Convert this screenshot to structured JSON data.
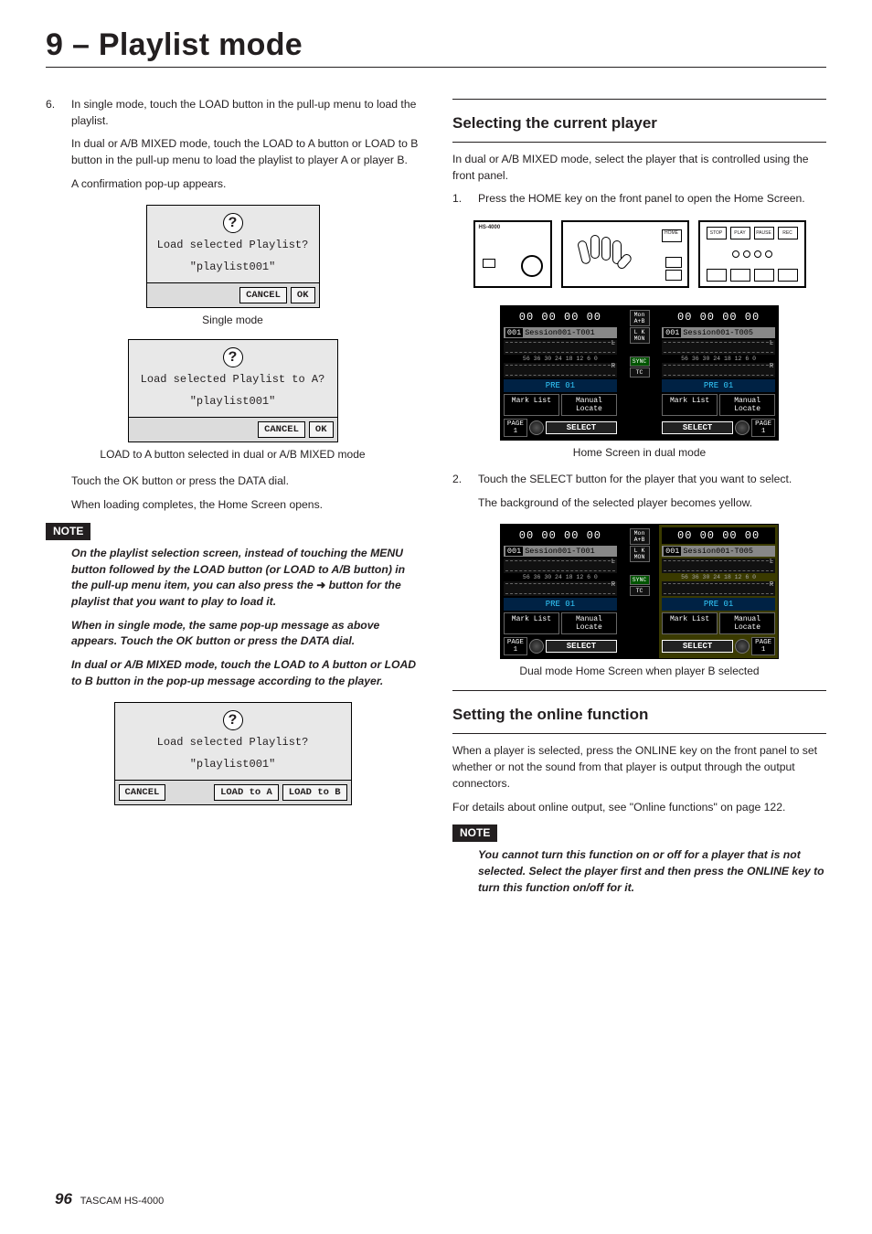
{
  "page": {
    "chapter_title": "9 – Playlist mode",
    "number": "96",
    "product": "TASCAM  HS-4000"
  },
  "left": {
    "step6_num": "6.",
    "step6_p1": "In single mode, touch the LOAD button in the pull-up menu to load the playlist.",
    "step6_p2": "In dual or A/B MIXED mode, touch the LOAD to A button or LOAD to B button in the pull-up menu to load the playlist to player A or player B.",
    "step6_p3": "A confirmation pop-up appears.",
    "popup1_line1": "Load selected Playlist?",
    "popup1_line2": "\"playlist001\"",
    "popup_cancel": "CANCEL",
    "popup_ok": "OK",
    "cap1": "Single mode",
    "popup2_line1": "Load selected Playlist to A?",
    "popup2_line2": "\"playlist001\"",
    "cap2": "LOAD to A button selected in dual or A/B MIXED mode",
    "after1": "Touch the OK button or press the DATA dial.",
    "after2": "When loading completes, the Home Screen opens.",
    "note_label": "NOTE",
    "note_p1a": "On the playlist selection screen, instead of touching the MENU button followed by the LOAD button (or LOAD to A/B button) in the pull-up menu item, you can also press the ",
    "note_p1b": " button for the playlist that you want to play to load it.",
    "note_p2": "When in single mode, the same pop-up message as above appears. Touch the OK button or press the DATA dial.",
    "note_p3": "In dual or A/B MIXED mode, touch the LOAD to A button or LOAD to B button in the pop-up message according to the player.",
    "popup3_line1": "Load selected Playlist?",
    "popup3_line2": "\"playlist001\"",
    "popup3_btn_cancel": "CANCEL",
    "popup3_btn_a": "LOAD to A",
    "popup3_btn_b": "LOAD to B"
  },
  "right": {
    "h_current": "Selecting the current player",
    "cur_p1": "In dual or A/B MIXED mode, select the player that is controlled using the front panel.",
    "cur_step1_num": "1.",
    "cur_step1": "Press the HOME key on the front panel to open the Home Screen.",
    "device_brand": "HS-4000",
    "device_btns": {
      "stop": "STOP",
      "play": "PLAY",
      "pause": "PAUSE",
      "rec": "REC"
    },
    "screen": {
      "tc_a": "00 00 00 00",
      "tc_b": "00 00 00 00",
      "trk_a_num": "001",
      "trk_a": "Session001-T001",
      "trk_b_num": "001",
      "trk_b": "Session001-T005",
      "meter_scale": "56 36 30 24  18 12  6   0",
      "pre": "PRE  01",
      "mark": "Mark List",
      "manloc": "Manual Locate",
      "mon": "Mon A+B",
      "lk": "L K MON",
      "sync": "SYNC",
      "tc_lbl": "TC",
      "page_lbl": "PAGE",
      "page_no": "1",
      "select": "SELECT"
    },
    "cap_home": "Home Screen in dual mode",
    "cur_step2_num": "2.",
    "cur_step2_p1": "Touch the SELECT button for the player that you want to select.",
    "cur_step2_p2": "The background of the selected player becomes yellow.",
    "cap_sel": "Dual mode Home Screen when player B selected",
    "h_online": "Setting the online function",
    "on_p1": "When a player is selected, press the ONLINE key on the front panel to set whether or not the sound from that player is output through the output connectors.",
    "on_p2": "For details about online output, see \"Online functions\" on page 122.",
    "on_note": "You cannot turn this function on or off for a player that is not selected. Select the player first and then press the ONLINE key to turn this function on/off for it."
  }
}
